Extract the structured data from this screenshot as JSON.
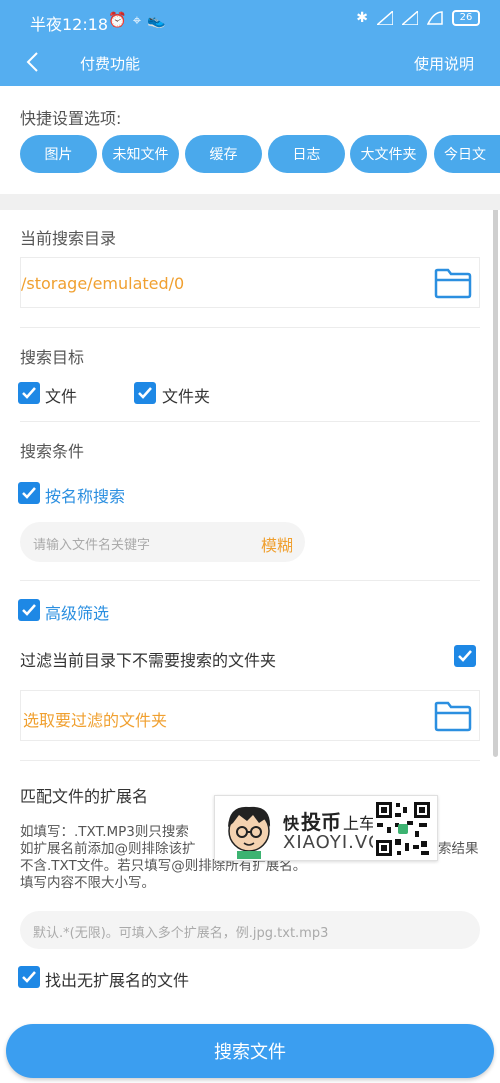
{
  "statusbar": {
    "time": "半夜12:18",
    "battery": "26"
  },
  "appbar": {
    "title": "付费功能",
    "help": "使用说明"
  },
  "quick_settings": {
    "label": "快捷设置选项:",
    "chips": [
      "图片",
      "未知文件",
      "缓存",
      "日志",
      "大文件夹",
      "今日文"
    ]
  },
  "current_dir": {
    "label": "当前搜索目录",
    "path": "/storage/emulated/0"
  },
  "search_target": {
    "label": "搜索目标",
    "options": [
      {
        "label": "文件",
        "checked": true
      },
      {
        "label": "文件夹",
        "checked": true
      }
    ]
  },
  "search_condition": {
    "label": "搜索条件",
    "by_name_label": "按名称搜索",
    "by_name_checked": true,
    "keyword_placeholder": "请输入文件名关键字",
    "fuzzy_label": "模糊"
  },
  "advanced": {
    "label": "高级筛选",
    "checked": true,
    "filter_folders_label": "过滤当前目录下不需要搜索的文件夹",
    "filter_folders_checked": true,
    "select_folders_label": "选取要过滤的文件夹"
  },
  "extension": {
    "label": "匹配文件的扩展名",
    "desc_line1": "如填写：.TXT.MP3则只搜索",
    "desc_line2": "如扩展名前添加@则排除该扩",
    "desc_line2_tail": "索结果",
    "desc_line3": "不含.TXT文件。若只填写@则排除所有扩展名。",
    "desc_line4": "填写内容不限大小写。",
    "placeholder": "默认.*(无限)。可填入多个扩展名，例.jpg.txt.mp3",
    "no_ext_label": "找出无扩展名的文件",
    "no_ext_checked": true
  },
  "watermark": {
    "line1_a": "快",
    "line1_b": "投币",
    "line1_c": "上车",
    "line2": "XIAOYI.VC"
  },
  "search_button": "搜索文件",
  "colors": {
    "primary": "#55aef0",
    "accent_orange": "#f0a030",
    "checkbox": "#1e88e5",
    "button": "#3b9ef0"
  }
}
